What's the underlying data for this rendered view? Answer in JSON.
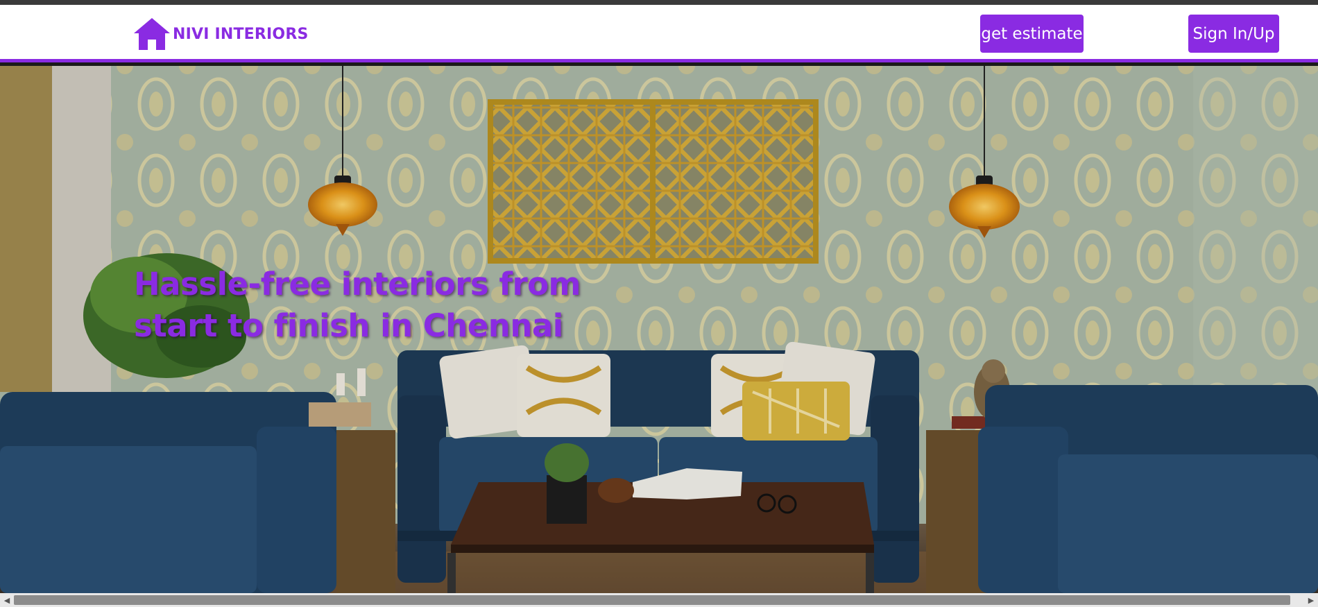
{
  "navbar": {
    "brand_name": "NIVI INTERIORS",
    "brand_icon": "home-icon",
    "estimate_label": "get estimate",
    "signin_label": "Sign In/Up"
  },
  "hero": {
    "headline": "Hassle-free interiors from start to finish in Chennai",
    "background": "living-room-photo"
  },
  "colors": {
    "accent": "#8a2be2",
    "navbar_bg": "#ffffff"
  }
}
